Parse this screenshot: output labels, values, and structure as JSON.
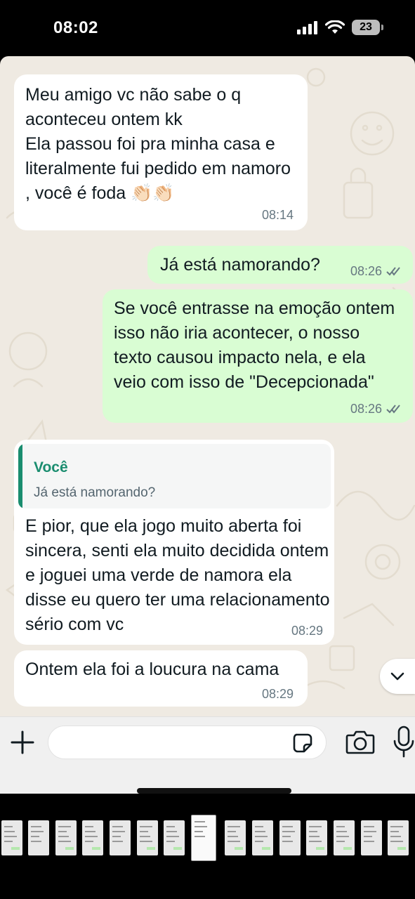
{
  "status_bar": {
    "time": "08:02",
    "battery": "23",
    "icons": [
      "signal-icon",
      "wifi-icon",
      "battery-icon"
    ]
  },
  "messages": [
    {
      "direction": "incoming",
      "text": "Meu amigo vc não sabe o q aconteceu ontem kk\nEla passou foi pra minha casa e literalmente fui pedido em namoro ,  você é foda 👏🏻👏🏻",
      "time": "08:14"
    },
    {
      "direction": "outgoing",
      "text": "Já está namorando?",
      "time": "08:26",
      "status": "read"
    },
    {
      "direction": "outgoing",
      "text": "Se você entrasse na emoção ontem isso não iria acontecer, o nosso texto causou impacto nela, e ela veio com isso de \"Decepcionada\"",
      "time": "08:26",
      "status": "read"
    },
    {
      "direction": "incoming",
      "quote": {
        "author": "Você",
        "text": "Já está namorando?"
      },
      "text": "E pior, que ela jogo muito aberta foi sincera, senti ela muito decidida ontem e joguei uma verde de namora ela disse eu quero ter uma relacionamento sério com vc",
      "time": "08:29"
    },
    {
      "direction": "incoming",
      "text": "Ontem ela foi a loucura na cama",
      "time": "08:29"
    }
  ],
  "composer": {
    "placeholder": "",
    "icons": [
      "plus-icon",
      "sticker-icon",
      "camera-icon",
      "mic-icon"
    ]
  },
  "colors": {
    "chat_background": "#efeae2",
    "incoming_bubble": "#ffffff",
    "outgoing_bubble": "#d9fdd3",
    "read_ticks": "#667781",
    "quote_accent": "#1a8d6f"
  },
  "thumbnails": {
    "count": 15,
    "active_index": 7
  }
}
